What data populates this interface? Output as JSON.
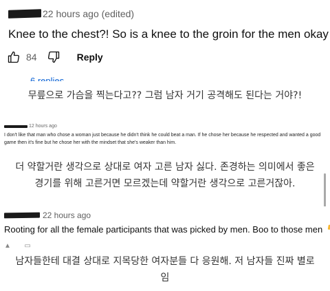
{
  "comment1": {
    "timestamp": "22 hours ago (edited)",
    "text": "Knee to the chest?! So is a knee to the groin for the men okay too?!",
    "like_count": "84",
    "reply_label": "Reply",
    "replies_label": "6 replies"
  },
  "translation1": "무릎으로 가슴을 찍는다고?? 그럼 남자 거기 공격해도 된다는 거야?!",
  "comment2": {
    "timestamp": "12 hours ago",
    "text": "I don't like that man who chose a woman just because he didn't think he could beat a man. If he chose her because he respected and wanted a good game then it's fine but he chose her with the mindset that she's weaker than him."
  },
  "translation2": {
    "line1": "더 약할거란 생각으로 상대로 여자 고른 남자 싫다. 존경하는 의미에서 좋은",
    "line2": "경기를 위해 고른거면 모르겠는데 약할거란 생각으로 고른거잖아."
  },
  "comment3": {
    "timestamp": "22 hours ago",
    "text": "Rooting for all the female participants that was picked by men. Boo to those men",
    "emoji": "thumbs-down-emoji"
  },
  "translation3": {
    "line1": "남자들한테 대결 상대로 지목당한 여자분들 다 응원해. 저 남자들 진짜 별로",
    "line2": "임"
  }
}
